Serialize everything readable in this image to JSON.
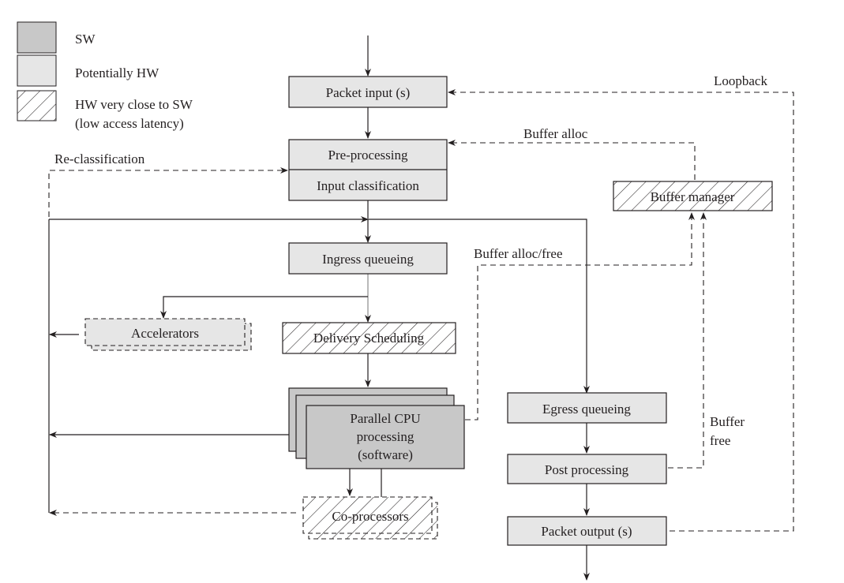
{
  "legend": {
    "items": [
      {
        "key": "sw",
        "label": "SW",
        "fill": "#c8c8c8"
      },
      {
        "key": "potential_hw",
        "label": "Potentially HW",
        "fill": "#e6e6e6"
      },
      {
        "key": "hw_close",
        "label_line1": "HW very close to SW",
        "label_line2": "(low access latency)",
        "fill": "hatched"
      }
    ]
  },
  "colors": {
    "sw": "#c8c8c8",
    "potential_hw": "#e6e6e6",
    "stroke": "#231f20"
  },
  "boxes": {
    "packet_input": "Packet input (s)",
    "pre_processing": "Pre-processing",
    "input_classification": "Input classification",
    "ingress_queueing": "Ingress queueing",
    "accelerators": "Accelerators",
    "delivery_scheduling": "Delivery Scheduling",
    "parallel_cpu_line1": "Parallel CPU",
    "parallel_cpu_line2": "processing",
    "parallel_cpu_line3": "(software)",
    "co_processors": "Co-processors",
    "buffer_manager": "Buffer manager",
    "egress_queueing": "Egress queueing",
    "post_processing": "Post processing",
    "packet_output": "Packet output (s)"
  },
  "edge_labels": {
    "loopback": "Loopback",
    "buffer_alloc": "Buffer alloc",
    "re_classification": "Re-classification",
    "buffer_alloc_free": "Buffer alloc/free",
    "buffer_free_line1": "Buffer",
    "buffer_free_line2": "free"
  }
}
